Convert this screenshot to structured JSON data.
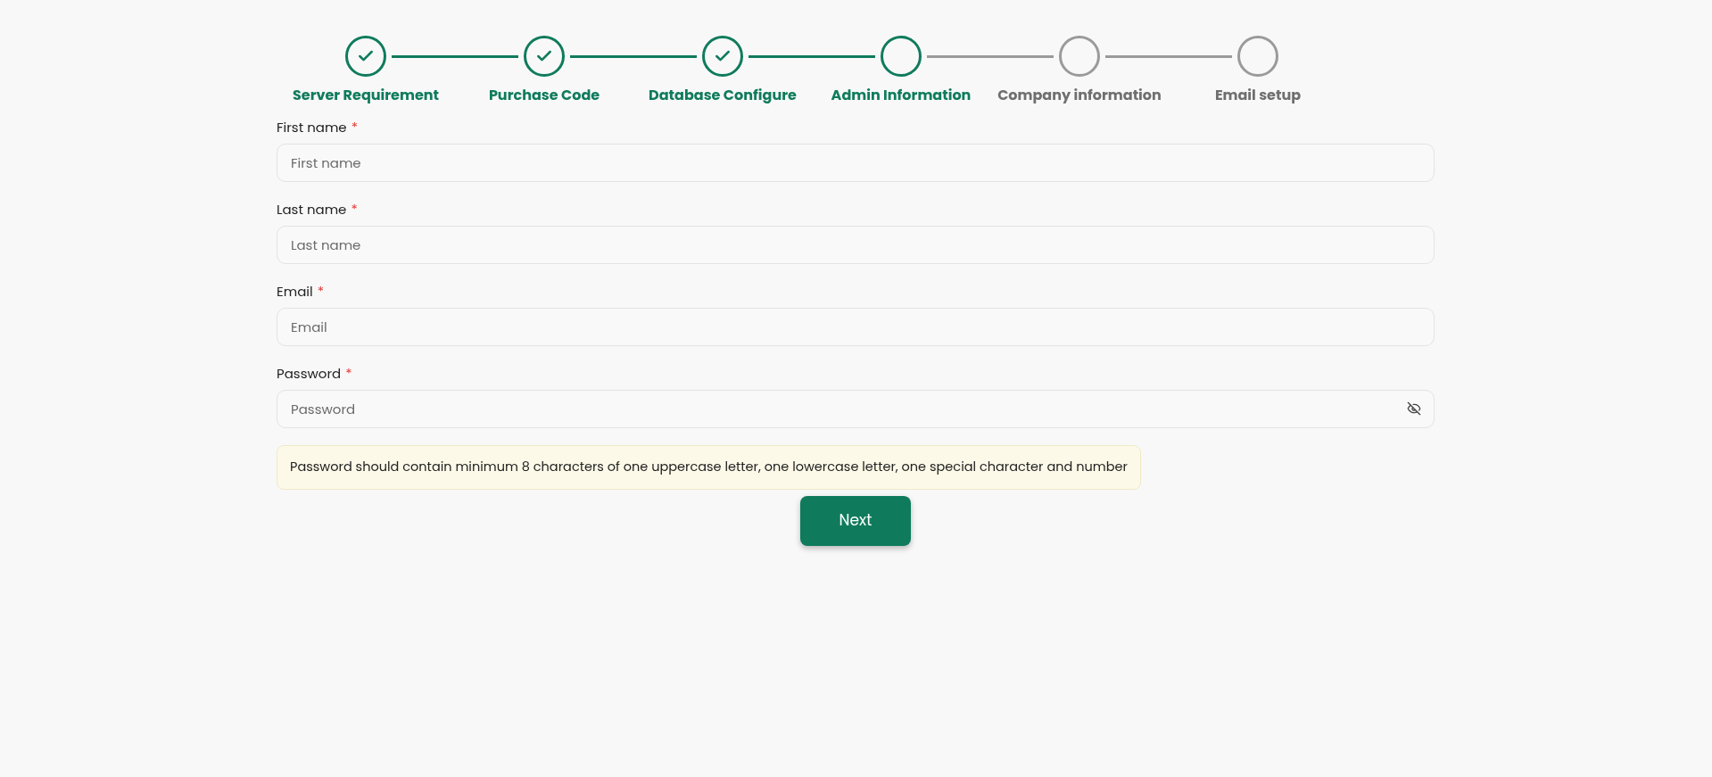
{
  "steps": [
    {
      "label": "Server Requirement",
      "completed": true,
      "reached": true
    },
    {
      "label": "Purchase Code",
      "completed": true,
      "reached": true
    },
    {
      "label": "Database Configure",
      "completed": true,
      "reached": true
    },
    {
      "label": "Admin Information",
      "completed": false,
      "reached": true
    },
    {
      "label": "Company information",
      "completed": false,
      "reached": false
    },
    {
      "label": "Email setup",
      "completed": false,
      "reached": false
    }
  ],
  "fields": [
    {
      "label": "First name",
      "required": true,
      "placeholder": "First name",
      "kind": "text"
    },
    {
      "label": "Last name",
      "required": true,
      "placeholder": "Last name",
      "kind": "text"
    },
    {
      "label": "Email",
      "required": true,
      "placeholder": "Email",
      "kind": "email"
    },
    {
      "label": "Password",
      "required": true,
      "placeholder": "Password",
      "kind": "password"
    }
  ],
  "required_mark": "*",
  "hint": "Password should contain minimum 8 characters of one uppercase letter, one lowercase letter, one special character and number",
  "next_button": "Next"
}
